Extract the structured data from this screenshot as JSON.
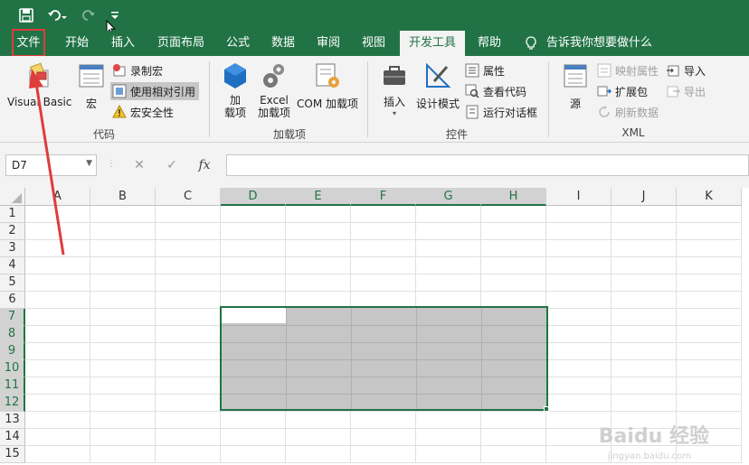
{
  "qat": {
    "save_icon": "save-icon",
    "undo_icon": "undo-icon",
    "redo_icon": "redo-icon",
    "customize_icon": "customize-qat-icon"
  },
  "tabs": [
    {
      "label": "文件"
    },
    {
      "label": "开始"
    },
    {
      "label": "插入"
    },
    {
      "label": "页面布局"
    },
    {
      "label": "公式"
    },
    {
      "label": "数据"
    },
    {
      "label": "审阅"
    },
    {
      "label": "视图"
    },
    {
      "label": "开发工具"
    },
    {
      "label": "帮助"
    }
  ],
  "tell_me": {
    "icon": "lightbulb-icon",
    "label": "告诉我你想要做什么"
  },
  "ribbon": {
    "code": {
      "visual_basic": "Visual Basic",
      "macros": "宏",
      "record_macro": "录制宏",
      "relative_refs": "使用相对引用",
      "macro_security": "宏安全性",
      "group_label": "代码"
    },
    "addins": {
      "addins_line1": "加",
      "addins_line2": "载项",
      "excel_line1": "Excel",
      "excel_line2": "加载项",
      "com": "COM 加载项",
      "group_label": "加载项"
    },
    "controls": {
      "insert": "插入",
      "design_mode": "设计模式",
      "properties": "属性",
      "view_code": "查看代码",
      "run_dialog": "运行对话框",
      "group_label": "控件"
    },
    "xml": {
      "source": "源",
      "map_properties": "映射属性",
      "expansion_packs": "扩展包",
      "refresh_data": "刷新数据",
      "import": "导入",
      "export": "导出",
      "group_label": "XML"
    }
  },
  "formula_bar": {
    "name_box": "D7",
    "cancel": "✕",
    "enter": "✓",
    "fx": "fx",
    "value": ""
  },
  "sheet": {
    "columns": [
      "A",
      "B",
      "C",
      "D",
      "E",
      "F",
      "G",
      "H",
      "I",
      "J",
      "K"
    ],
    "rows": [
      "1",
      "2",
      "3",
      "4",
      "5",
      "6",
      "7",
      "8",
      "9",
      "10",
      "11",
      "12",
      "13",
      "14",
      "15"
    ],
    "selected_range": "D7:H12",
    "active_cell": "D7"
  },
  "watermark": {
    "line1": "Baidu 经验",
    "line2": "jingyan.baidu.com"
  },
  "colors": {
    "brand": "#217346",
    "annotation": "#e03c3c"
  }
}
